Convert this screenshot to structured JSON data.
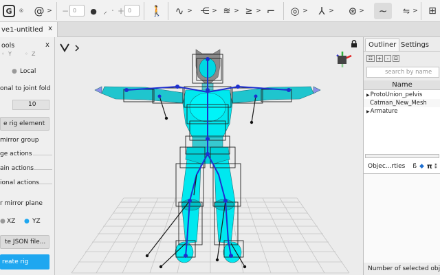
{
  "toolbar": {
    "counter1": "0",
    "counter2": "0"
  },
  "file_tab": {
    "title": "ve1-untitled",
    "close": "x"
  },
  "tool_panel": {
    "title": "ools",
    "close": "x",
    "axis_y": "Y",
    "axis_z": "Z",
    "local_label": "Local",
    "joint_fold_label": "onal to joint fold",
    "joint_value": "10",
    "create_element_button": "e rig element",
    "mirror_group": "mirror group",
    "ge_actions": "ge actions",
    "ain_actions": "ain actions",
    "tional_actions": "ional actions",
    "mirror_plane_label": "r mirror plane",
    "plane_xz": "XZ",
    "plane_yz": "YZ",
    "json_button": "te JSON file...",
    "create_rig_button": "reate rig"
  },
  "right_panel": {
    "tabs": [
      "Outliner",
      "Settings"
    ],
    "search_placeholder": "search by name",
    "name_header": "Name",
    "items": [
      "ProtoUnion_pelvis",
      "Catman_New_Mesh",
      "Armature"
    ],
    "props_title": "Objec...rties",
    "props_icons": [
      "ß",
      "π"
    ],
    "selected_count_label": "Number of selected objec"
  },
  "colors": {
    "accent_blue": "#1ea7f0",
    "mesh_cyan": "#00e8ef",
    "bone_blue": "#1e2fd0"
  },
  "icons": [
    "grid-icon",
    "spiral-icon",
    "dot-icon",
    "figure-icon",
    "wave-icon",
    "bones-icon",
    "gizmo-icon",
    "camera-icon",
    "tilde-icon",
    "viewport-cube-icon",
    "lock-icon"
  ]
}
